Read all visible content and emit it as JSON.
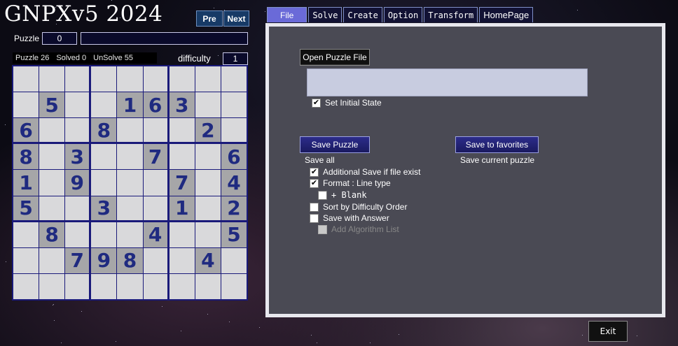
{
  "app_title": "GNPXv5 2024",
  "nav": {
    "pre": "Pre",
    "next": "Next"
  },
  "puzzle": {
    "label": "Puzzle",
    "index": "0",
    "name": ""
  },
  "stats": {
    "puzzle": "Puzzle 26",
    "solved": "Solved 0",
    "unsolved": "UnSolve 55",
    "difficulty_label": "difficulty",
    "difficulty": "1"
  },
  "grid": [
    [
      "",
      "",
      "",
      "",
      "",
      "",
      "",
      "",
      ""
    ],
    [
      "",
      "5",
      "",
      "",
      "1",
      "6",
      "3",
      "",
      ""
    ],
    [
      "6",
      "",
      "",
      "8",
      "",
      "",
      "",
      "2",
      ""
    ],
    [
      "8",
      "",
      "3",
      "",
      "",
      "7",
      "",
      "",
      "6"
    ],
    [
      "1",
      "",
      "9",
      "",
      "",
      "",
      "7",
      "",
      "4"
    ],
    [
      "5",
      "",
      "",
      "3",
      "",
      "",
      "1",
      "",
      "2"
    ],
    [
      "",
      "8",
      "",
      "",
      "",
      "4",
      "",
      "",
      "5"
    ],
    [
      "",
      "",
      "7",
      "9",
      "8",
      "",
      "",
      "4",
      ""
    ],
    [
      "",
      "",
      "",
      "",
      "",
      "",
      "",
      "",
      ""
    ]
  ],
  "tabs": [
    {
      "label": "File",
      "active": true
    },
    {
      "label": "Solve"
    },
    {
      "label": "Create"
    },
    {
      "label": "Option"
    },
    {
      "label": "Transform"
    },
    {
      "label": "HomePage"
    }
  ],
  "file_panel": {
    "open_button": "Open Puzzle File",
    "file_path": "",
    "set_initial_state": "Set Initial State",
    "save_puzzle_button": "Save Puzzle",
    "save_all": "Save all",
    "save_favorites_button": "Save to favorites",
    "save_current": "Save current puzzle",
    "options": [
      {
        "label": "Additional Save if file exist",
        "checked": true
      },
      {
        "label": "Format : Line type",
        "checked": true
      },
      {
        "label": "+ Blank",
        "checked": false
      },
      {
        "label": "Sort by Difficulty Order",
        "checked": false
      },
      {
        "label": "Save with Answer",
        "checked": false
      },
      {
        "label": "Add Algorithm List",
        "checked": false,
        "disabled": true
      }
    ]
  },
  "exit_button": "Exit"
}
